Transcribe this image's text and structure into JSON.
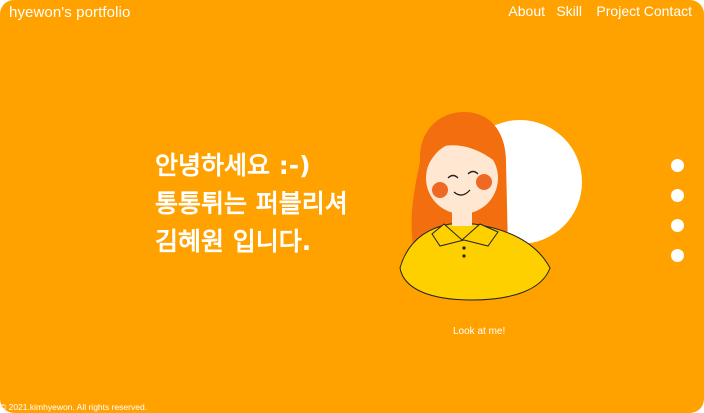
{
  "header": {
    "brand": "hyewon's portfolio",
    "nav": [
      {
        "label": "About"
      },
      {
        "label": "Skill"
      },
      {
        "label": "Project"
      },
      {
        "label": "Contact"
      }
    ]
  },
  "hero": {
    "lines": [
      "안녕하세요 :-)",
      "통통튀는 퍼블리셔",
      "김혜원 입니다."
    ]
  },
  "illustration": {
    "caption": "Look at me!"
  },
  "pager": {
    "count": 4
  },
  "footer": {
    "copyright": "© 2021.kimhyewon. All rights reserved."
  },
  "colors": {
    "background": "#ffa200",
    "hair": "#f26e0f",
    "shirt": "#ffd000",
    "circle": "#ffffff",
    "text": "#ffffff"
  }
}
